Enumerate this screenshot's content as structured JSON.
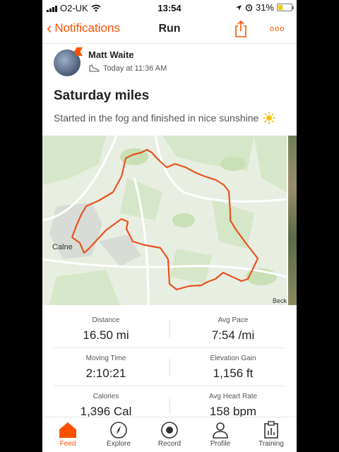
{
  "status_bar": {
    "carrier": "O2-UK",
    "time": "13:54",
    "battery": "31%",
    "battery_level": 0.31
  },
  "nav": {
    "back_label": "Notifications",
    "title": "Run",
    "more_label": "ooo",
    "accent": "#fc5200"
  },
  "activity": {
    "athlete_name": "Matt Waite",
    "timestamp": "Today at 11:36 AM",
    "title": "Saturday miles",
    "description": "Started in the fog and finished in nice sunshine"
  },
  "map": {
    "place_labels": [
      "Calne",
      "Beck"
    ],
    "route_color": "#e8531d"
  },
  "stats": [
    [
      {
        "label": "Distance",
        "value": "16.50 mi"
      },
      {
        "label": "Avg Pace",
        "value": "7:54 /mi"
      }
    ],
    [
      {
        "label": "Moving Time",
        "value": "2:10:21"
      },
      {
        "label": "Elevation Gain",
        "value": "1,156 ft"
      }
    ],
    [
      {
        "label": "Calories",
        "value": "1,396 Cal"
      },
      {
        "label": "Avg Heart Rate",
        "value": "158 bpm"
      }
    ]
  ],
  "tabs": [
    {
      "label": "Feed",
      "icon": "home-icon",
      "active": true
    },
    {
      "label": "Explore",
      "icon": "compass-icon",
      "active": false
    },
    {
      "label": "Record",
      "icon": "record-icon",
      "active": false
    },
    {
      "label": "Profile",
      "icon": "person-icon",
      "active": false
    },
    {
      "label": "Training",
      "icon": "clipboard-icon",
      "active": false
    }
  ]
}
